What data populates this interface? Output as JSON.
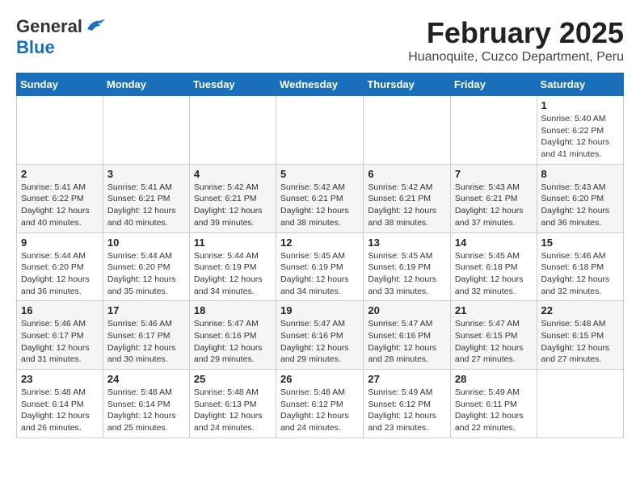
{
  "header": {
    "logo_general": "General",
    "logo_blue": "Blue",
    "month_year": "February 2025",
    "location": "Huanoquite, Cuzco Department, Peru"
  },
  "weekdays": [
    "Sunday",
    "Monday",
    "Tuesday",
    "Wednesday",
    "Thursday",
    "Friday",
    "Saturday"
  ],
  "weeks": [
    [
      {
        "day": "",
        "info": ""
      },
      {
        "day": "",
        "info": ""
      },
      {
        "day": "",
        "info": ""
      },
      {
        "day": "",
        "info": ""
      },
      {
        "day": "",
        "info": ""
      },
      {
        "day": "",
        "info": ""
      },
      {
        "day": "1",
        "info": "Sunrise: 5:40 AM\nSunset: 6:22 PM\nDaylight: 12 hours\nand 41 minutes."
      }
    ],
    [
      {
        "day": "2",
        "info": "Sunrise: 5:41 AM\nSunset: 6:22 PM\nDaylight: 12 hours\nand 40 minutes."
      },
      {
        "day": "3",
        "info": "Sunrise: 5:41 AM\nSunset: 6:21 PM\nDaylight: 12 hours\nand 40 minutes."
      },
      {
        "day": "4",
        "info": "Sunrise: 5:42 AM\nSunset: 6:21 PM\nDaylight: 12 hours\nand 39 minutes."
      },
      {
        "day": "5",
        "info": "Sunrise: 5:42 AM\nSunset: 6:21 PM\nDaylight: 12 hours\nand 38 minutes."
      },
      {
        "day": "6",
        "info": "Sunrise: 5:42 AM\nSunset: 6:21 PM\nDaylight: 12 hours\nand 38 minutes."
      },
      {
        "day": "7",
        "info": "Sunrise: 5:43 AM\nSunset: 6:21 PM\nDaylight: 12 hours\nand 37 minutes."
      },
      {
        "day": "8",
        "info": "Sunrise: 5:43 AM\nSunset: 6:20 PM\nDaylight: 12 hours\nand 36 minutes."
      }
    ],
    [
      {
        "day": "9",
        "info": "Sunrise: 5:44 AM\nSunset: 6:20 PM\nDaylight: 12 hours\nand 36 minutes."
      },
      {
        "day": "10",
        "info": "Sunrise: 5:44 AM\nSunset: 6:20 PM\nDaylight: 12 hours\nand 35 minutes."
      },
      {
        "day": "11",
        "info": "Sunrise: 5:44 AM\nSunset: 6:19 PM\nDaylight: 12 hours\nand 34 minutes."
      },
      {
        "day": "12",
        "info": "Sunrise: 5:45 AM\nSunset: 6:19 PM\nDaylight: 12 hours\nand 34 minutes."
      },
      {
        "day": "13",
        "info": "Sunrise: 5:45 AM\nSunset: 6:19 PM\nDaylight: 12 hours\nand 33 minutes."
      },
      {
        "day": "14",
        "info": "Sunrise: 5:45 AM\nSunset: 6:18 PM\nDaylight: 12 hours\nand 32 minutes."
      },
      {
        "day": "15",
        "info": "Sunrise: 5:46 AM\nSunset: 6:18 PM\nDaylight: 12 hours\nand 32 minutes."
      }
    ],
    [
      {
        "day": "16",
        "info": "Sunrise: 5:46 AM\nSunset: 6:17 PM\nDaylight: 12 hours\nand 31 minutes."
      },
      {
        "day": "17",
        "info": "Sunrise: 5:46 AM\nSunset: 6:17 PM\nDaylight: 12 hours\nand 30 minutes."
      },
      {
        "day": "18",
        "info": "Sunrise: 5:47 AM\nSunset: 6:16 PM\nDaylight: 12 hours\nand 29 minutes."
      },
      {
        "day": "19",
        "info": "Sunrise: 5:47 AM\nSunset: 6:16 PM\nDaylight: 12 hours\nand 29 minutes."
      },
      {
        "day": "20",
        "info": "Sunrise: 5:47 AM\nSunset: 6:16 PM\nDaylight: 12 hours\nand 28 minutes."
      },
      {
        "day": "21",
        "info": "Sunrise: 5:47 AM\nSunset: 6:15 PM\nDaylight: 12 hours\nand 27 minutes."
      },
      {
        "day": "22",
        "info": "Sunrise: 5:48 AM\nSunset: 6:15 PM\nDaylight: 12 hours\nand 27 minutes."
      }
    ],
    [
      {
        "day": "23",
        "info": "Sunrise: 5:48 AM\nSunset: 6:14 PM\nDaylight: 12 hours\nand 26 minutes."
      },
      {
        "day": "24",
        "info": "Sunrise: 5:48 AM\nSunset: 6:14 PM\nDaylight: 12 hours\nand 25 minutes."
      },
      {
        "day": "25",
        "info": "Sunrise: 5:48 AM\nSunset: 6:13 PM\nDaylight: 12 hours\nand 24 minutes."
      },
      {
        "day": "26",
        "info": "Sunrise: 5:48 AM\nSunset: 6:12 PM\nDaylight: 12 hours\nand 24 minutes."
      },
      {
        "day": "27",
        "info": "Sunrise: 5:49 AM\nSunset: 6:12 PM\nDaylight: 12 hours\nand 23 minutes."
      },
      {
        "day": "28",
        "info": "Sunrise: 5:49 AM\nSunset: 6:11 PM\nDaylight: 12 hours\nand 22 minutes."
      },
      {
        "day": "",
        "info": ""
      }
    ]
  ]
}
